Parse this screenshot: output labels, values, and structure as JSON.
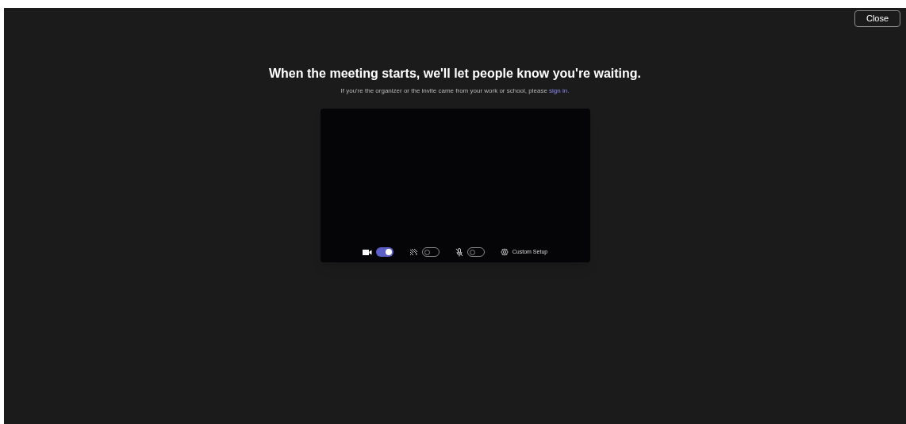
{
  "close_button": "Close",
  "heading": "When the meeting starts, we'll let people know you're waiting.",
  "subtext": {
    "text": "If you're the organizer or the invite came from your work or school, please",
    "link": "sign in."
  },
  "controls": [
    {
      "kind": "camera",
      "on": true
    },
    {
      "kind": "effects",
      "on": false
    },
    {
      "kind": "mic",
      "on": false
    }
  ],
  "setup_button": "Custom Setup"
}
